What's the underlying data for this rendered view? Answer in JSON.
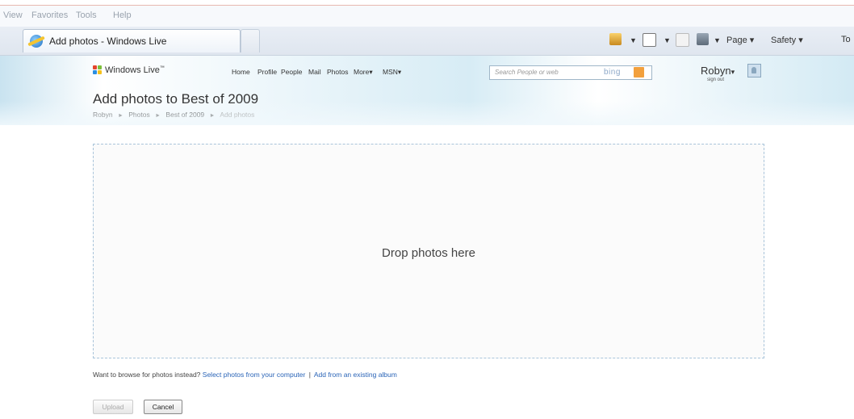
{
  "ie_menu": {
    "items": [
      "View",
      "Favorites",
      "Tools",
      "Help"
    ]
  },
  "tab": {
    "title": "Add photos - Windows Live"
  },
  "commandbar": {
    "page_label": "Page",
    "safety_label": "Safety",
    "tools_label": "To"
  },
  "header": {
    "brand": "Windows Live",
    "brand_tm": "™",
    "nav": [
      "Home",
      "Profile",
      "People",
      "Mail",
      "Photos",
      "More",
      "MSN"
    ],
    "more_caret": "▾",
    "search_placeholder": "Search People or web",
    "bing_label": "bing",
    "user_name": "Robyn",
    "user_caret": "▾",
    "sign_out": "sign out"
  },
  "page": {
    "title": "Add photos to Best of 2009",
    "breadcrumb": [
      "Robyn",
      "Photos",
      "Best of 2009",
      "Add photos"
    ],
    "breadcrumb_sep": "►"
  },
  "dropzone": {
    "label": "Drop photos here"
  },
  "browse": {
    "prompt": "Want to browse for photos instead?",
    "select_link": "Select photos from your computer",
    "divider": "|",
    "album_link": "Add from an existing album"
  },
  "buttons": {
    "upload": "Upload",
    "cancel": "Cancel"
  },
  "colors": {
    "link": "#2a64b7",
    "dropzone_border": "#a9c4da",
    "header_band": "#d7ecf5"
  }
}
